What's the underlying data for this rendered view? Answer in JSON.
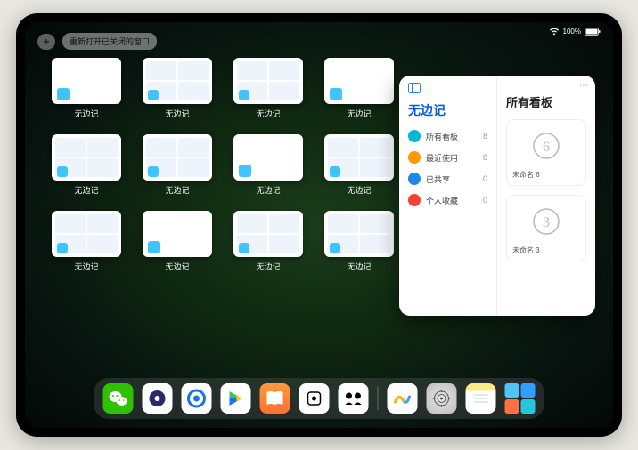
{
  "status": {
    "battery_text": "100%"
  },
  "toolbar": {
    "plus_label": "+",
    "reopen_label": "重新打开已关闭的窗口"
  },
  "app_name": "无边记",
  "windows": [
    {
      "label": "无边记",
      "variant": "blank"
    },
    {
      "label": "无边记",
      "variant": "grid"
    },
    {
      "label": "无边记",
      "variant": "grid"
    },
    {
      "label": "无边记",
      "variant": "blank"
    },
    {
      "label": "无边记",
      "variant": "grid"
    },
    {
      "label": "无边记",
      "variant": "grid"
    },
    {
      "label": "无边记",
      "variant": "blank"
    },
    {
      "label": "无边记",
      "variant": "grid"
    },
    {
      "label": "无边记",
      "variant": "grid"
    },
    {
      "label": "无边记",
      "variant": "blank"
    },
    {
      "label": "无边记",
      "variant": "grid"
    },
    {
      "label": "无边记",
      "variant": "grid"
    }
  ],
  "panel": {
    "left_title": "无边记",
    "items": [
      {
        "icon_color": "#00b8d4",
        "label": "所有看板",
        "count": 8
      },
      {
        "icon_color": "#ff9800",
        "label": "最近使用",
        "count": 8
      },
      {
        "icon_color": "#1e88e5",
        "label": "已共享",
        "count": 0
      },
      {
        "icon_color": "#f44336",
        "label": "个人收藏",
        "count": 0
      }
    ],
    "right_title": "所有看板",
    "boards": [
      {
        "digit": "6",
        "label": "未命名 6",
        "sub": ""
      },
      {
        "digit": "3",
        "label": "未命名 3",
        "sub": ""
      }
    ]
  },
  "dock": [
    {
      "name": "wechat-icon",
      "bg": "#2dc100"
    },
    {
      "name": "clock-icon",
      "bg": "#ffffff"
    },
    {
      "name": "qqbrowser-icon",
      "bg": "#ffffff"
    },
    {
      "name": "play-icon",
      "bg": "#ffffff"
    },
    {
      "name": "books-icon",
      "bg": "#ff9500"
    },
    {
      "name": "dice-icon",
      "bg": "#ffffff"
    },
    {
      "name": "meet-icon",
      "bg": "#ffffff"
    },
    {
      "name": "freeform-icon",
      "bg": "#ffffff"
    },
    {
      "name": "settings-icon",
      "bg": "#d6d6d6"
    },
    {
      "name": "notes-icon",
      "bg": "#ffffff"
    },
    {
      "name": "app-library-icon",
      "bg": ""
    }
  ]
}
